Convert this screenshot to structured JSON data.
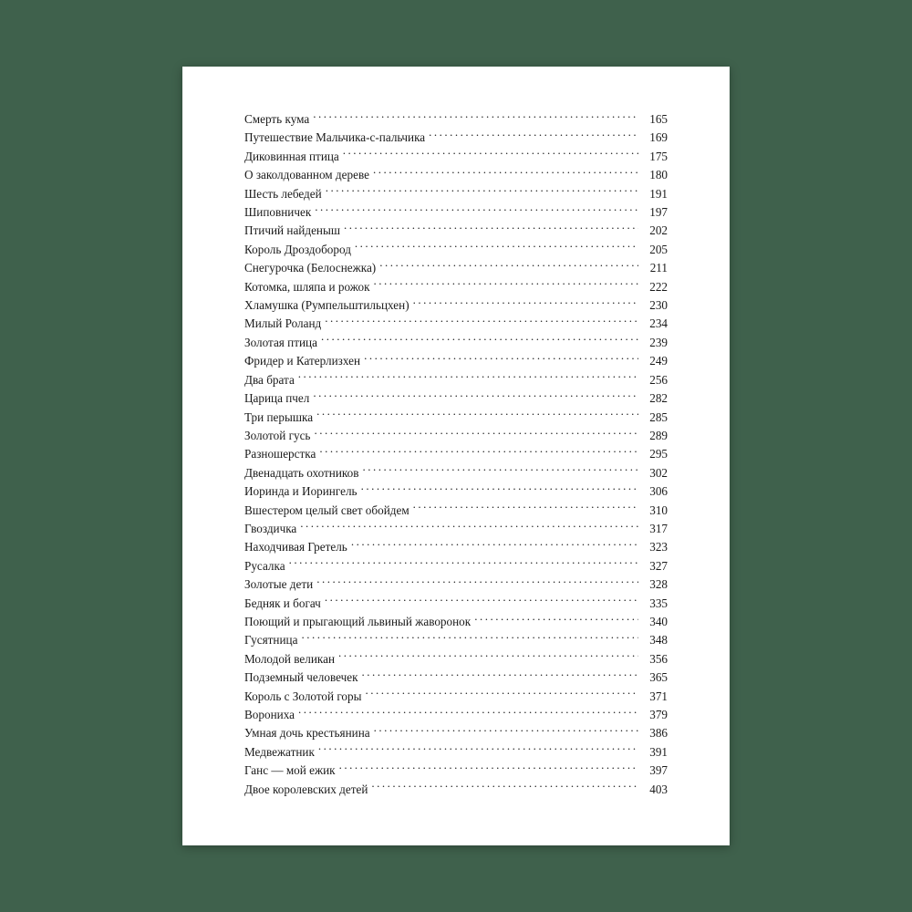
{
  "toc": {
    "entries": [
      {
        "title": "Смерть кума",
        "page": "165"
      },
      {
        "title": "Путешествие Мальчика-с-пальчика",
        "page": "169"
      },
      {
        "title": "Диковинная птица",
        "page": "175"
      },
      {
        "title": "О заколдованном дереве",
        "page": "180"
      },
      {
        "title": "Шесть лебедей",
        "page": "191"
      },
      {
        "title": "Шиповничек",
        "page": "197"
      },
      {
        "title": "Птичий найденыш",
        "page": "202"
      },
      {
        "title": "Король Дроздобород",
        "page": "205"
      },
      {
        "title": "Снегурочка (Белоснежка)",
        "page": "211"
      },
      {
        "title": "Котомка, шляпа и рожок",
        "page": "222"
      },
      {
        "title": "Хламушка (Румпельштильцхен)",
        "page": "230"
      },
      {
        "title": "Милый Роланд",
        "page": "234"
      },
      {
        "title": "Золотая птица",
        "page": "239"
      },
      {
        "title": "Фридер и Катерлизхен",
        "page": "249"
      },
      {
        "title": "Два брата",
        "page": "256"
      },
      {
        "title": "Царица пчел",
        "page": "282"
      },
      {
        "title": "Три перышка",
        "page": "285"
      },
      {
        "title": "Золотой гусь",
        "page": "289"
      },
      {
        "title": "Разношерстка",
        "page": "295"
      },
      {
        "title": "Двенадцать охотников",
        "page": "302"
      },
      {
        "title": "Иоринда и Иорингель",
        "page": "306"
      },
      {
        "title": "Вшестером целый свет обойдем",
        "page": "310"
      },
      {
        "title": "Гвоздичка",
        "page": "317"
      },
      {
        "title": "Находчивая Гретель",
        "page": "323"
      },
      {
        "title": "Русалка",
        "page": "327"
      },
      {
        "title": "Золотые дети",
        "page": "328"
      },
      {
        "title": "Бедняк и богач",
        "page": "335"
      },
      {
        "title": "Поющий и прыгающий львиный жаворонок",
        "page": "340"
      },
      {
        "title": "Гусятница",
        "page": "348"
      },
      {
        "title": "Молодой великан",
        "page": "356"
      },
      {
        "title": "Подземный человечек",
        "page": "365"
      },
      {
        "title": "Король с Золотой горы",
        "page": "371"
      },
      {
        "title": "Ворониха",
        "page": "379"
      },
      {
        "title": "Умная дочь крестьянина",
        "page": "386"
      },
      {
        "title": "Медвежатник",
        "page": "391"
      },
      {
        "title": "Ганс — мой ежик",
        "page": "397"
      },
      {
        "title": "Двое королевских детей",
        "page": "403"
      }
    ]
  }
}
